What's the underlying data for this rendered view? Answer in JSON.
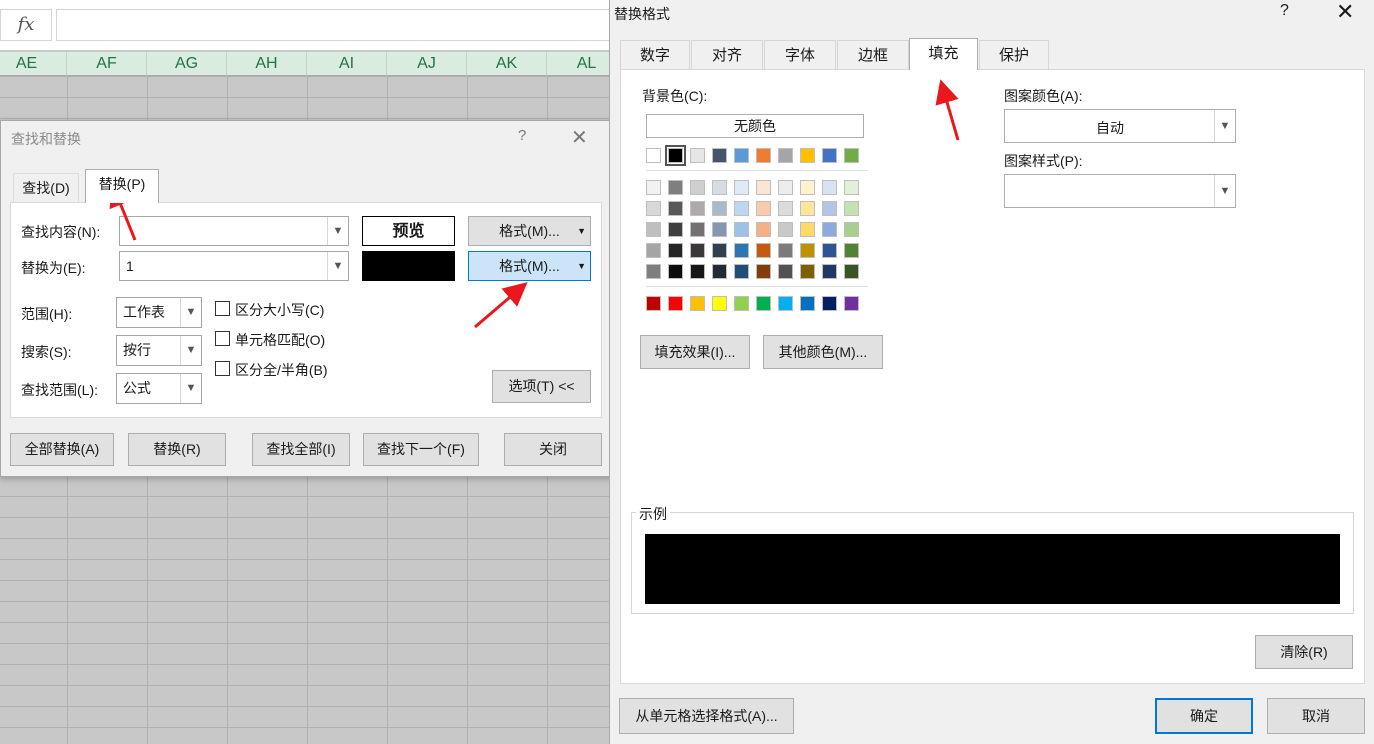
{
  "spreadsheet": {
    "fx_label": "fx",
    "columns": [
      "AE",
      "AF",
      "AG",
      "AH",
      "AI",
      "AJ",
      "AK",
      "AL"
    ]
  },
  "find_replace": {
    "title": "查找和替换",
    "help": "?",
    "close": "✕",
    "tab_find": "查找(D)",
    "tab_replace": "替换(P)",
    "find_label": "查找内容(N):",
    "replace_label": "替换为(E):",
    "find_value": "",
    "replace_value": "1",
    "preview_label": "预览",
    "format_btn_1": "格式(M)...",
    "format_btn_2": "格式(M)...",
    "scope_label": "范围(H):",
    "scope_value": "工作表",
    "search_label": "搜索(S):",
    "search_value": "按行",
    "lookin_label": "查找范围(L):",
    "lookin_value": "公式",
    "match_case": "区分大小写(C)",
    "match_cell": "单元格匹配(O)",
    "match_width": "区分全/半角(B)",
    "options_btn": "选项(T) <<",
    "replace_all": "全部替换(A)",
    "replace": "替换(R)",
    "find_all": "查找全部(I)",
    "find_next": "查找下一个(F)",
    "close_btn": "关闭"
  },
  "format_dialog": {
    "title": "替换格式",
    "help": "?",
    "close": "✕",
    "tabs": [
      "数字",
      "对齐",
      "字体",
      "边框",
      "填充",
      "保护"
    ],
    "active_tab": "填充",
    "bg_color_label": "背景色(C):",
    "no_color": "无颜色",
    "pattern_color_label": "图案颜色(A):",
    "pattern_color_value": "自动",
    "pattern_style_label": "图案样式(P):",
    "pattern_style_value": "",
    "fill_effects": "填充效果(I)...",
    "more_colors": "其他颜色(M)...",
    "sample_label": "示例",
    "clear": "清除(R)",
    "from_cell": "从单元格选择格式(A)...",
    "ok": "确定",
    "cancel": "取消",
    "sample_color": "#000000",
    "theme_row": [
      "#ffffff",
      "#000000",
      "#e7e6e6",
      "#44546a",
      "#5b9bd5",
      "#ed7d31",
      "#a5a5a5",
      "#ffc000",
      "#4472c4",
      "#70ad47"
    ],
    "tint_rows": [
      [
        "#f2f2f2",
        "#7f7f7f",
        "#d0cece",
        "#d6dce4",
        "#deebf6",
        "#fbe5d5",
        "#ededed",
        "#fff2cc",
        "#d9e2f3",
        "#e2efd9"
      ],
      [
        "#d8d8d8",
        "#595959",
        "#aeaaaa",
        "#acb9ca",
        "#bdd7ee",
        "#f7cbac",
        "#dbdbdb",
        "#fee599",
        "#b4c6e7",
        "#c5e0b3"
      ],
      [
        "#bfbfbf",
        "#3f3f3f",
        "#757070",
        "#8496b0",
        "#9cc3e5",
        "#f4b183",
        "#c9c9c9",
        "#ffd965",
        "#8eaadb",
        "#a8d08d"
      ],
      [
        "#a5a5a5",
        "#262626",
        "#3a3838",
        "#323f4f",
        "#2e75b5",
        "#c55a11",
        "#7b7b7b",
        "#bf9000",
        "#2f5496",
        "#538135"
      ],
      [
        "#7f7f7f",
        "#0c0c0c",
        "#171616",
        "#222a35",
        "#1f4e79",
        "#833c0b",
        "#525252",
        "#7f6000",
        "#1f3864",
        "#375623"
      ]
    ],
    "standard_row": [
      "#c00000",
      "#ff0000",
      "#ffc000",
      "#ffff00",
      "#92d050",
      "#00b050",
      "#00b0f0",
      "#0070c0",
      "#002060",
      "#7030a0"
    ]
  }
}
